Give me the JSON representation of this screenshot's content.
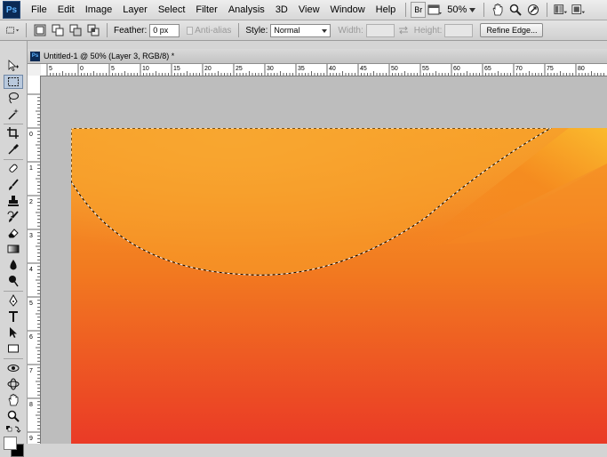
{
  "app": {
    "logo": "Ps"
  },
  "menu": [
    "File",
    "Edit",
    "Image",
    "Layer",
    "Select",
    "Filter",
    "Analysis",
    "3D",
    "View",
    "Window",
    "Help"
  ],
  "menubar": {
    "bridge_label": "Br",
    "zoom": "50%",
    "tools_icons": [
      "hand-icon",
      "zoom-icon",
      "rotate-icon"
    ]
  },
  "options": {
    "feather_label": "Feather:",
    "feather_value": "0 px",
    "antialias_label": "Anti-alias",
    "style_label": "Style:",
    "style_value": "Normal",
    "width_label": "Width:",
    "height_label": "Height:",
    "refine_label": "Refine Edge..."
  },
  "document": {
    "title": "Untitled-1 @ 50% (Layer 3, RGB/8) *"
  },
  "rulers": {
    "h_labels": [
      "5",
      "0",
      "5",
      "10",
      "15",
      "20",
      "25",
      "30",
      "35",
      "40",
      "45",
      "50",
      "55",
      "60",
      "65",
      "70",
      "75",
      "80"
    ],
    "v_labels": [
      "0",
      "1",
      "2",
      "3",
      "4",
      "5",
      "6",
      "7",
      "8",
      "9"
    ]
  },
  "colors": {
    "orange_top": "#f7a12a",
    "orange_mid": "#f27a20",
    "red_bottom": "#ea3a26"
  }
}
